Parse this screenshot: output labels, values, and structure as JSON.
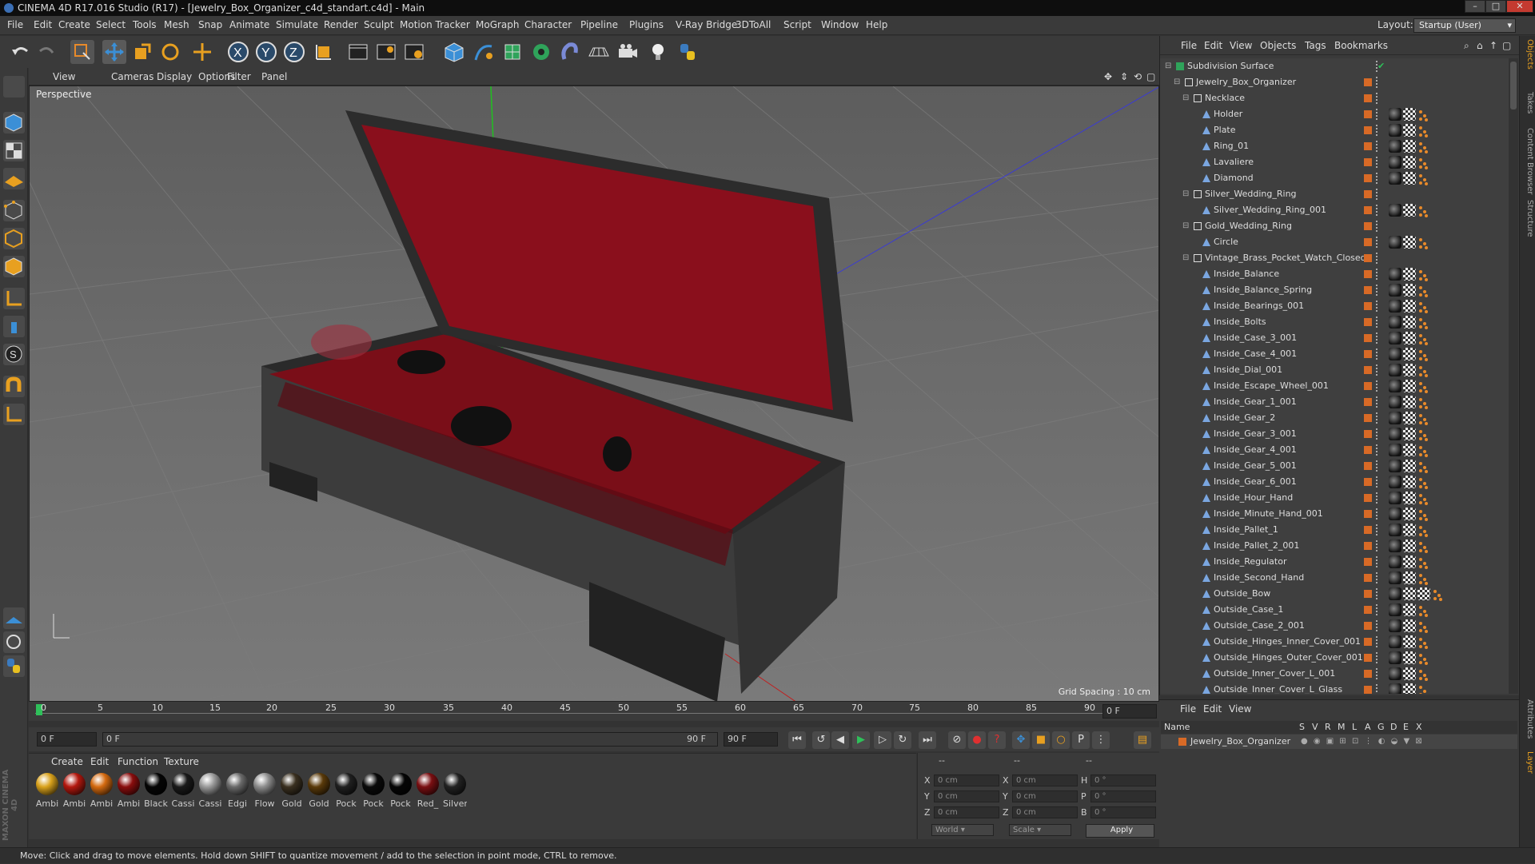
{
  "titlebar": {
    "title": "CINEMA 4D R17.016 Studio (R17) - [Jewelry_Box_Organizer_c4d_standart.c4d] - Main"
  },
  "menubar": {
    "items": [
      "File",
      "Edit",
      "Create",
      "Select",
      "Tools",
      "Mesh",
      "Snap",
      "Animate",
      "Simulate",
      "Render",
      "Sculpt",
      "Motion Tracker",
      "MoGraph",
      "Character",
      "Pipeline",
      "Plugins",
      "V-Ray Bridge",
      "3DToAll",
      "Script",
      "Window",
      "Help"
    ],
    "layout_label": "Layout:",
    "layout_value": "Startup (User)"
  },
  "viewport": {
    "menu": [
      "View",
      "Cameras",
      "Display",
      "Options",
      "Filter",
      "Panel"
    ],
    "label": "Perspective",
    "grid_spacing": "Grid Spacing : 10 cm"
  },
  "timeline": {
    "ticks": [
      "0",
      "5",
      "10",
      "15",
      "20",
      "25",
      "30",
      "35",
      "40",
      "45",
      "50",
      "55",
      "60",
      "65",
      "70",
      "75",
      "80",
      "85",
      "90"
    ],
    "current_frame": "0 F",
    "start_field": "0 F",
    "range_start": "0 F",
    "range_end": "90 F",
    "end_field": "90 F"
  },
  "materials": {
    "menu": [
      "Create",
      "Edit",
      "Function",
      "Texture"
    ],
    "items": [
      {
        "label": "Ambi",
        "color": "#d9a21c"
      },
      {
        "label": "Ambi",
        "color": "#b3180e"
      },
      {
        "label": "Ambi",
        "color": "#d46a10"
      },
      {
        "label": "Ambi",
        "color": "#8a0d0d"
      },
      {
        "label": "Black",
        "color": "#050505"
      },
      {
        "label": "Cassi",
        "color": "#1a1a1a"
      },
      {
        "label": "Cassi",
        "color": "#9a9a9a"
      },
      {
        "label": "Edgi",
        "color": "#6a6a6a"
      },
      {
        "label": "Flow",
        "color": "#8d8d8d"
      },
      {
        "label": "Gold",
        "color": "#3a3020"
      },
      {
        "label": "Gold",
        "color": "#5a3a0a"
      },
      {
        "label": "Pock",
        "color": "#202020"
      },
      {
        "label": "Pock",
        "color": "#0a0a0a"
      },
      {
        "label": "Pock",
        "color": "#050505"
      },
      {
        "label": "Red_",
        "color": "#7a0f12"
      },
      {
        "label": "Silver",
        "color": "#222222"
      }
    ]
  },
  "coords": {
    "header": [
      "--",
      "--",
      "--"
    ],
    "rows": [
      {
        "a": "X",
        "av": "0 cm",
        "b": "X",
        "bv": "0 cm",
        "c": "H",
        "cv": "0 °"
      },
      {
        "a": "Y",
        "av": "0 cm",
        "b": "Y",
        "bv": "0 cm",
        "c": "P",
        "cv": "0 °"
      },
      {
        "a": "Z",
        "av": "0 cm",
        "b": "Z",
        "bv": "0 cm",
        "c": "B",
        "cv": "0 °"
      }
    ],
    "world": "World",
    "scale": "Scale",
    "apply": "Apply"
  },
  "objects": {
    "menu": [
      "File",
      "Edit",
      "View",
      "Objects",
      "Tags",
      "Bookmarks"
    ],
    "rows": [
      {
        "name": "Subdivision Surface",
        "indent": 0,
        "type": "subd",
        "tags": 0
      },
      {
        "name": "Jewelry_Box_Organizer",
        "indent": 1,
        "type": "null",
        "tags": 0
      },
      {
        "name": "Necklace",
        "indent": 2,
        "type": "null",
        "tags": 0
      },
      {
        "name": "Holder",
        "indent": 3,
        "type": "poly",
        "tags": 3
      },
      {
        "name": "Plate",
        "indent": 3,
        "type": "poly",
        "tags": 3
      },
      {
        "name": "Ring_01",
        "indent": 3,
        "type": "poly",
        "tags": 3
      },
      {
        "name": "Lavaliere",
        "indent": 3,
        "type": "poly",
        "tags": 3
      },
      {
        "name": "Diamond",
        "indent": 3,
        "type": "poly",
        "tags": 3
      },
      {
        "name": "Silver_Wedding_Ring",
        "indent": 2,
        "type": "null",
        "tags": 0
      },
      {
        "name": "Silver_Wedding_Ring_001",
        "indent": 3,
        "type": "poly",
        "tags": 3
      },
      {
        "name": "Gold_Wedding_Ring",
        "indent": 2,
        "type": "null",
        "tags": 0
      },
      {
        "name": "Circle",
        "indent": 3,
        "type": "poly",
        "tags": 3
      },
      {
        "name": "Vintage_Brass_Pocket_Watch_Closed",
        "indent": 2,
        "type": "null",
        "tags": 0
      },
      {
        "name": "Inside_Balance",
        "indent": 3,
        "type": "poly",
        "tags": 3
      },
      {
        "name": "Inside_Balance_Spring",
        "indent": 3,
        "type": "poly",
        "tags": 3
      },
      {
        "name": "Inside_Bearings_001",
        "indent": 3,
        "type": "poly",
        "tags": 3
      },
      {
        "name": "Inside_Bolts",
        "indent": 3,
        "type": "poly",
        "tags": 3
      },
      {
        "name": "Inside_Case_3_001",
        "indent": 3,
        "type": "poly",
        "tags": 3
      },
      {
        "name": "Inside_Case_4_001",
        "indent": 3,
        "type": "poly",
        "tags": 3
      },
      {
        "name": "Inside_Dial_001",
        "indent": 3,
        "type": "poly",
        "tags": 3
      },
      {
        "name": "Inside_Escape_Wheel_001",
        "indent": 3,
        "type": "poly",
        "tags": 3
      },
      {
        "name": "Inside_Gear_1_001",
        "indent": 3,
        "type": "poly",
        "tags": 3
      },
      {
        "name": "Inside_Gear_2",
        "indent": 3,
        "type": "poly",
        "tags": 3
      },
      {
        "name": "Inside_Gear_3_001",
        "indent": 3,
        "type": "poly",
        "tags": 3
      },
      {
        "name": "Inside_Gear_4_001",
        "indent": 3,
        "type": "poly",
        "tags": 3
      },
      {
        "name": "Inside_Gear_5_001",
        "indent": 3,
        "type": "poly",
        "tags": 3
      },
      {
        "name": "Inside_Gear_6_001",
        "indent": 3,
        "type": "poly",
        "tags": 3
      },
      {
        "name": "Inside_Hour_Hand",
        "indent": 3,
        "type": "poly",
        "tags": 3
      },
      {
        "name": "Inside_Minute_Hand_001",
        "indent": 3,
        "type": "poly",
        "tags": 3
      },
      {
        "name": "Inside_Pallet_1",
        "indent": 3,
        "type": "poly",
        "tags": 3
      },
      {
        "name": "Inside_Pallet_2_001",
        "indent": 3,
        "type": "poly",
        "tags": 3
      },
      {
        "name": "Inside_Regulator",
        "indent": 3,
        "type": "poly",
        "tags": 3
      },
      {
        "name": "Inside_Second_Hand",
        "indent": 3,
        "type": "poly",
        "tags": 3
      },
      {
        "name": "Outside_Bow",
        "indent": 3,
        "type": "poly",
        "tags": 4
      },
      {
        "name": "Outside_Case_1",
        "indent": 3,
        "type": "poly",
        "tags": 3
      },
      {
        "name": "Outside_Case_2_001",
        "indent": 3,
        "type": "poly",
        "tags": 3
      },
      {
        "name": "Outside_Hinges_Inner_Cover_001",
        "indent": 3,
        "type": "poly",
        "tags": 3
      },
      {
        "name": "Outside_Hinges_Outer_Cover_001",
        "indent": 3,
        "type": "poly",
        "tags": 3
      },
      {
        "name": "Outside_Inner_Cover_L_001",
        "indent": 3,
        "type": "poly",
        "tags": 3
      },
      {
        "name": "Outside_Inner_Cover_L_Glass",
        "indent": 3,
        "type": "poly",
        "tags": 3
      }
    ]
  },
  "layers": {
    "menu": [
      "File",
      "Edit",
      "View"
    ],
    "header": {
      "name": "Name",
      "cols": [
        "S",
        "V",
        "R",
        "M",
        "L",
        "A",
        "G",
        "D",
        "E",
        "X"
      ]
    },
    "row": "Jewelry_Box_Organizer"
  },
  "right_tabs": [
    "Objects",
    "Takes",
    "Content Browser",
    "Structure",
    "Attributes",
    "Layer"
  ],
  "status": "Move: Click and drag to move elements. Hold down SHIFT to quantize movement / add to the selection in point mode, CTRL to remove.",
  "maxon": "MAXON CINEMA 4D"
}
